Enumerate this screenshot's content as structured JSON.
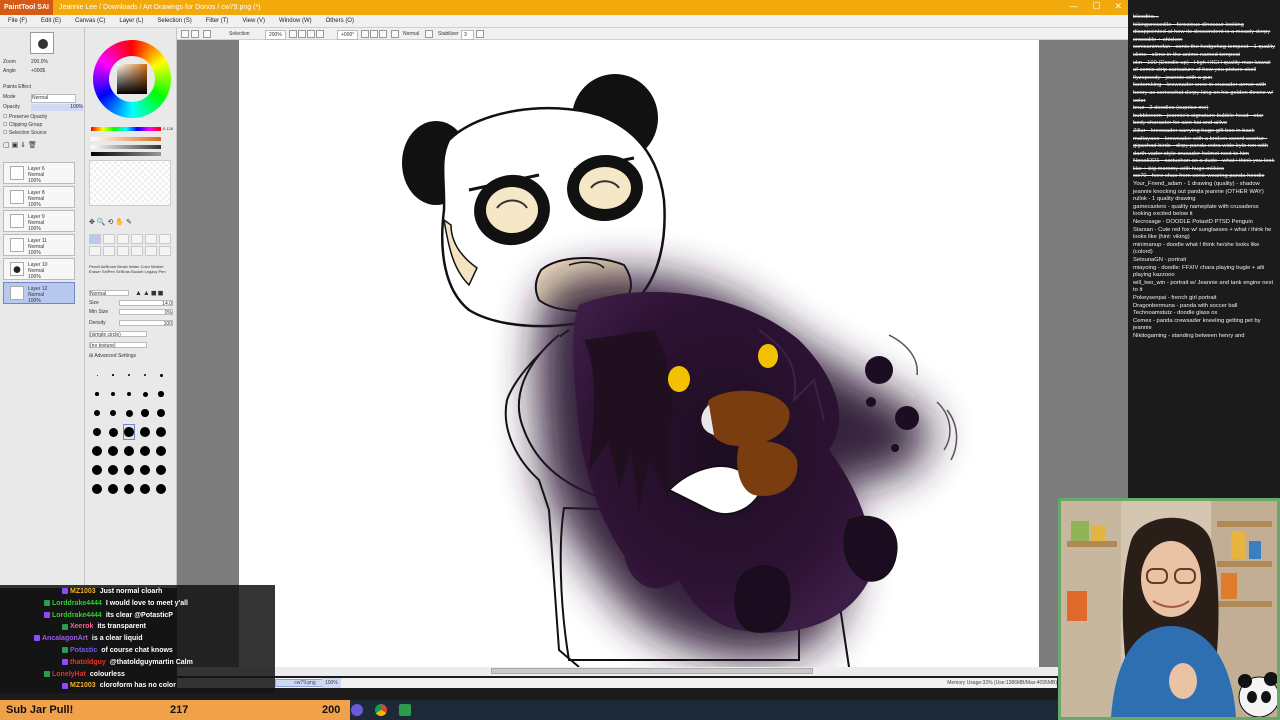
{
  "titlebar": {
    "app_logo": "PaintTool SAI",
    "path": "Jeannie Lee / Downloads / Art Drawings for Donos / cw79.png (*)",
    "minimize": "—",
    "maximize": "☐",
    "close": "✕"
  },
  "menu": [
    "File (F)",
    "Edit (E)",
    "Canvas (C)",
    "Layer (L)",
    "Selection (S)",
    "Filter (T)",
    "View (V)",
    "Window (W)",
    "Others (O)"
  ],
  "navigator": {
    "zoom_label": "Zoom",
    "zoom_value": "200.0%",
    "angle_label": "Angle",
    "angle_value": "+000$"
  },
  "layer_panel": {
    "paint_effect": "Paints Effect",
    "mode_label": "Mode",
    "mode_value": "Normal",
    "opacity_label": "Opacity",
    "opacity_value": "100%",
    "preserve_opacity": "Preserve Opacity",
    "clipping_group": "Clipping Group",
    "selection_source": "Selection Source",
    "layers": [
      {
        "name": "Layer 6",
        "mode": "Normal",
        "opacity": "100%"
      },
      {
        "name": "Layer 8",
        "mode": "Normal",
        "opacity": "100%"
      },
      {
        "name": "Layer 9",
        "mode": "Normal",
        "opacity": "100%"
      },
      {
        "name": "Layer 11",
        "mode": "Normal",
        "opacity": "100%"
      },
      {
        "name": "Layer 10",
        "mode": "Normal",
        "opacity": "100%"
      },
      {
        "name": "Layer 12",
        "mode": "Normal",
        "opacity": "100%"
      }
    ]
  },
  "tool_panel": {
    "hsv_value": "0.128",
    "brush_names": [
      "Pencil",
      "AirBrush",
      "Brush",
      "Water Color",
      "Marker",
      "Eraser",
      "SelPen",
      "SelEras",
      "Bucket",
      "Legacy Pen"
    ],
    "blend_mode": "Normal",
    "size_label": "Size",
    "size_value": "14.0",
    "min_size_label": "Min Size",
    "min_size_value": "0%",
    "density_label": "Density",
    "density_value": "100",
    "shape": "(simple circle)",
    "texture": "(no texture)",
    "advanced": "Advanced Settings",
    "size_presets": [
      "0.7",
      "0.8",
      "1",
      "1.5",
      "2",
      "2.3",
      "2.6",
      "3",
      "3.5",
      "4",
      "5",
      "6",
      "7",
      "8",
      "9",
      "10",
      "12",
      "14",
      "16",
      "20",
      "25",
      "30",
      "35",
      "40",
      "50",
      "60",
      "70",
      "80",
      "100",
      "120",
      "160",
      "200",
      "250",
      "300",
      "350"
    ]
  },
  "toolbar": {
    "selection": "Selection",
    "zoom": "200%",
    "angle": "+000°",
    "mode": "Normal",
    "stabilizer_label": "Stabilizer",
    "stabilizer_value": "3"
  },
  "status": {
    "open_file": "cw79.png",
    "zoom": "100%",
    "memory": "Memory Usage:33% (Use:1386MB/Max:4095MB)"
  },
  "chat": [
    {
      "user": "MZ1003",
      "user_color": "#f0b232",
      "message": "Just normal cloarh"
    },
    {
      "user": "Lorddrake4444",
      "user_color": "#38c838",
      "message": "I would love to meet y'all"
    },
    {
      "user": "Lorddrake4444",
      "user_color": "#38c838",
      "message": "its clear @PotasticP"
    },
    {
      "user": "Xeerok",
      "user_color": "#ff5d97",
      "message": "its transparent"
    },
    {
      "user": "AncalagonArt",
      "user_color": "#9b5de5",
      "message": "is a clear liquid"
    },
    {
      "user": "Potastic",
      "user_color": "#6e5df0",
      "message": "of course chat knows"
    },
    {
      "user": "thatoldguy",
      "user_color": "#e0352b",
      "message": "@thatoldguymartin Calm"
    },
    {
      "user": "LonelyHat",
      "user_color": "#e0352b",
      "message": "colourless"
    },
    {
      "user": "MZ1003",
      "user_color": "#f0b232",
      "message": "cloroform has no color"
    }
  ],
  "subjar": {
    "label": "Sub Jar Pull!",
    "count_a": "217",
    "count_b": "200"
  },
  "notes": [
    {
      "text": "bloodtra...",
      "done": true
    },
    {
      "text": "hikingcrocodile - ferocious dinosaur looking disappointed at how its descendent is a measly derpy crocodile + chicken",
      "done": true
    },
    {
      "text": "sonicanimefan - sonic the hedgehog tempest - 1 quality slime - slime in the anime named tempest",
      "done": true
    },
    {
      "text": "skn - 100 (Doodle up) - High HIGH quality max kawaii af comic strip caricature of how you picture skoll",
      "done": true
    },
    {
      "text": "flyzspeedy - jeannie with a gun",
      "done": true
    },
    {
      "text": "fantomking - krewsader crew in crusader armor with henry as somewhat derpy king on his golden throne w/ color",
      "done": true
    },
    {
      "text": "bruz - 2 doodles (suprise me)",
      "done": true
    },
    {
      "text": "bubblenom - jeannie's signature bubble head - star body character for aizo kai and aiilve",
      "done": true
    },
    {
      "text": "Zillur - krewsader carrying huge gift box in back",
      "done": true
    },
    {
      "text": "maltayaco - krewsader with a broken sword scortur - gigachad birds - dirpy panda extra wide kylo ren with darth vader style crusader helmet next to him",
      "done": true
    },
    {
      "text": "Nosa5321 - cartuchan as a dude - what i think you look like + big mommy with huge milkies",
      "done": true
    },
    {
      "text": "cw79 - here chao from sonic wearing panda hoodie",
      "done": true
    },
    {
      "text": "Your_Friend_adam - 1 drawing (quality) - shadow jeannie knocking out panda jeannie (OTHER WAY)",
      "done": false
    },
    {
      "text": "rullok - 1 quality drawing",
      "done": false
    },
    {
      "text": "gamecasters - quality nameplate with crusaderss looking excited below it",
      "done": false
    },
    {
      "text": "Necrosage - DOODLE PotastD PTSD Penguin",
      "done": false
    },
    {
      "text": "Starsan - Cute red fox w/ sunglasses + what i think he looks like (hint: viking)",
      "done": false
    },
    {
      "text": "minimanup - doodle what I think he/she looks like (colord)",
      "done": false
    },
    {
      "text": "SetsunaGN - portrait",
      "done": false
    },
    {
      "text": "miayoing - doodle: FFXIV chara playing bugle + alti playing kazzooo",
      "done": false
    },
    {
      "text": "will_two_win - portrait w/ Jeannie and tank engine next to it",
      "done": false
    },
    {
      "text": "Pokeysenpai - french girl portrait",
      "done": false
    },
    {
      "text": "Dragonbermuna - panda with soccer ball",
      "done": false
    },
    {
      "text": "Technoamstutz - doodle glass ox",
      "done": false
    },
    {
      "text": "Cemex - panda crewsader kneeling getting pet by jeannie",
      "done": false
    },
    {
      "text": "Nikitogaming - standing between henry and",
      "done": false
    }
  ],
  "colors": {
    "title_orange": "#f1a90b",
    "subjar_orange": "#f0a14a",
    "webcam_border": "#68a868",
    "shadow_purple": "#2a1430",
    "eye_yellow": "#f2c200",
    "mouth_brown": "#7a3d10"
  }
}
